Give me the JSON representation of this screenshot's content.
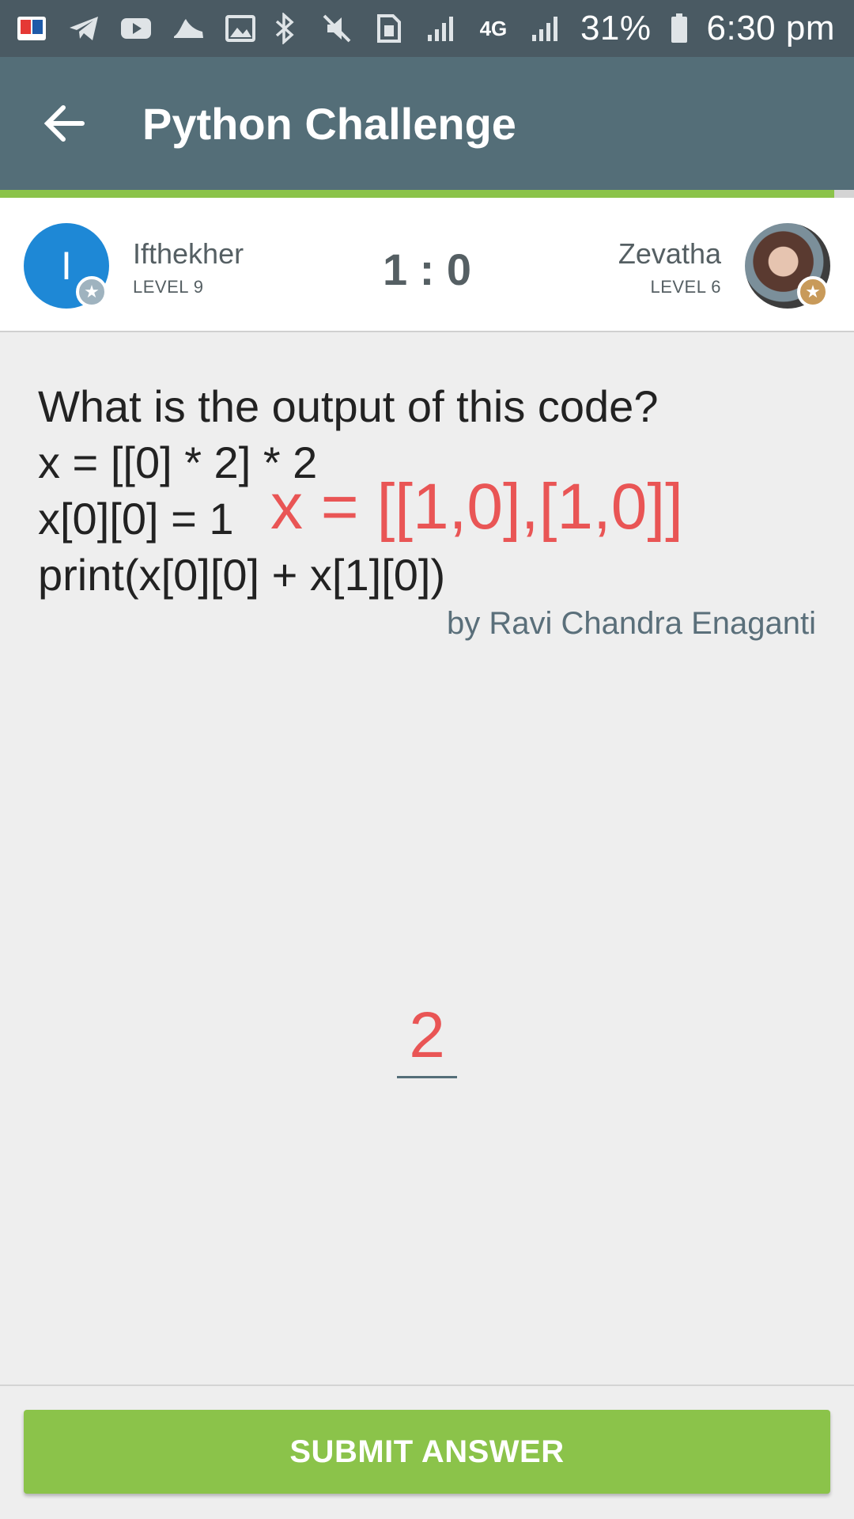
{
  "status_bar": {
    "battery": "31%",
    "time": "6:30 pm",
    "network": "4G",
    "icons": [
      "dictionary-app-icon",
      "telegram-icon",
      "youtube-icon",
      "shoe-icon",
      "gallery-icon",
      "bluetooth-icon",
      "mute-icon",
      "sim-icon",
      "signal-icon",
      "data-arrows-icon",
      "signal-icon",
      "battery-icon"
    ]
  },
  "app_bar": {
    "title": "Python Challenge",
    "back_icon": "arrow-left-icon"
  },
  "colors": {
    "status_bar": "#4a5a63",
    "app_bar": "#546e78",
    "accent_green": "#8bc34a",
    "annotation_red": "#e95555",
    "left_avatar": "#1e88d6"
  },
  "players": {
    "left": {
      "initial": "I",
      "name": "Ifthekher",
      "level": "LEVEL 9"
    },
    "right": {
      "name": "Zevatha",
      "level": "LEVEL 6"
    },
    "score": "1 : 0"
  },
  "question": {
    "lines": [
      "What is the output of this code?",
      "x = [[0] * 2] * 2",
      "x[0][0] = 1",
      "print(x[0][0] + x[1][0])"
    ],
    "annotation": "x = [[1,0],[1,0]]",
    "author": "by Ravi Chandra Enaganti"
  },
  "answer": {
    "value": "2"
  },
  "submit": {
    "label": "SUBMIT ANSWER"
  }
}
